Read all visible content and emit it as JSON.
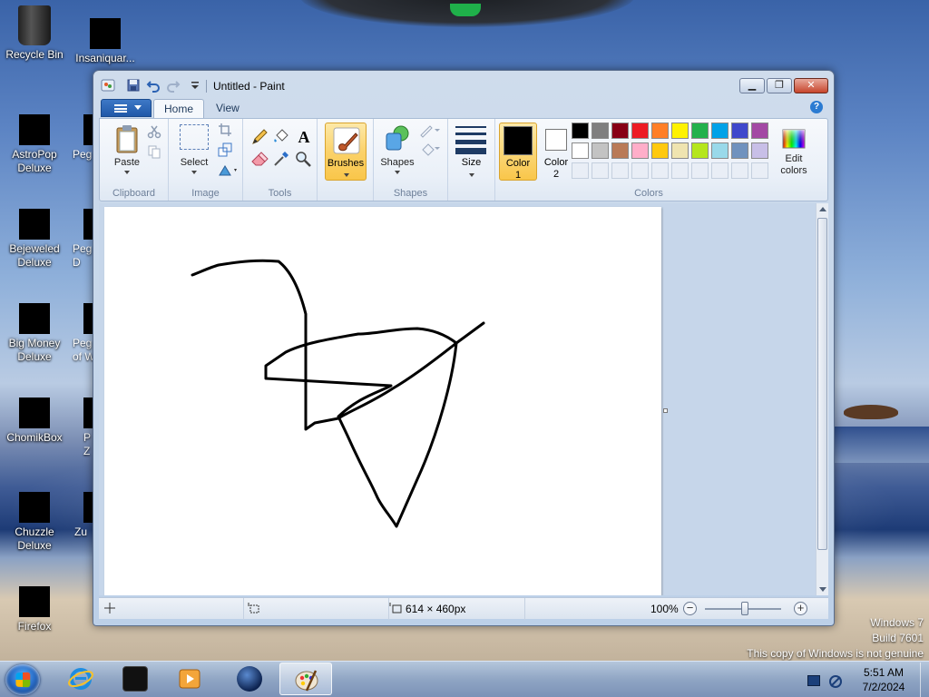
{
  "desktop": {
    "icons": [
      {
        "label": "Recycle Bin"
      },
      {
        "label": "Insaniquar..."
      },
      {
        "label": "AstroPop\nDeluxe"
      },
      {
        "label": "Bejeweled\nDeluxe"
      },
      {
        "label": "Big Money\nDeluxe"
      },
      {
        "label": "ChomikBox"
      },
      {
        "label": "Chuzzle\nDeluxe"
      },
      {
        "label": "Firefox"
      }
    ],
    "partial_labels": [
      "Peg",
      "Peg\nD",
      "Peg\nof W",
      "P\nZ",
      "Zu"
    ],
    "watermark": {
      "line1": "Windows 7",
      "line2": "Build 7601",
      "line3": "This copy of Windows is not genuine"
    }
  },
  "paint": {
    "title": "Untitled - Paint",
    "tabs": [
      "Home",
      "View"
    ],
    "help": "?",
    "groups": {
      "clipboard": {
        "label": "Clipboard",
        "paste": "Paste"
      },
      "image": {
        "label": "Image",
        "select": "Select"
      },
      "tools": {
        "label": "Tools",
        "text_tool": "A"
      },
      "brushes": {
        "label": "Brushes"
      },
      "shapes": {
        "label": "Shapes",
        "shapes": "Shapes"
      },
      "size": {
        "label": "Size"
      },
      "colors": {
        "label": "Colors",
        "color1": "Color\n1",
        "color2": "Color\n2",
        "edit_colors": "Edit\ncolors",
        "color1_value": "#000000",
        "color2_value": "#ffffff",
        "row1": [
          "#000000",
          "#7f7f7f",
          "#880015",
          "#ed1c24",
          "#ff7f27",
          "#fff200",
          "#22b14c",
          "#00a2e8",
          "#3f48cc",
          "#a349a4"
        ],
        "row2": [
          "#ffffff",
          "#c3c3c3",
          "#b97a57",
          "#ffaec9",
          "#ffc90e",
          "#efe4b0",
          "#b5e61d",
          "#99d9ea",
          "#7092be",
          "#c8bfe7"
        ]
      }
    },
    "status": {
      "canvas_size": "614 × 460px",
      "zoom": "100%",
      "zoom_minus": "−",
      "zoom_plus": "+"
    },
    "drawing": {
      "stroke_color": "#000000"
    }
  },
  "taskbar": {
    "clock_time": "5:51 AM",
    "clock_date": "7/2/2024"
  }
}
